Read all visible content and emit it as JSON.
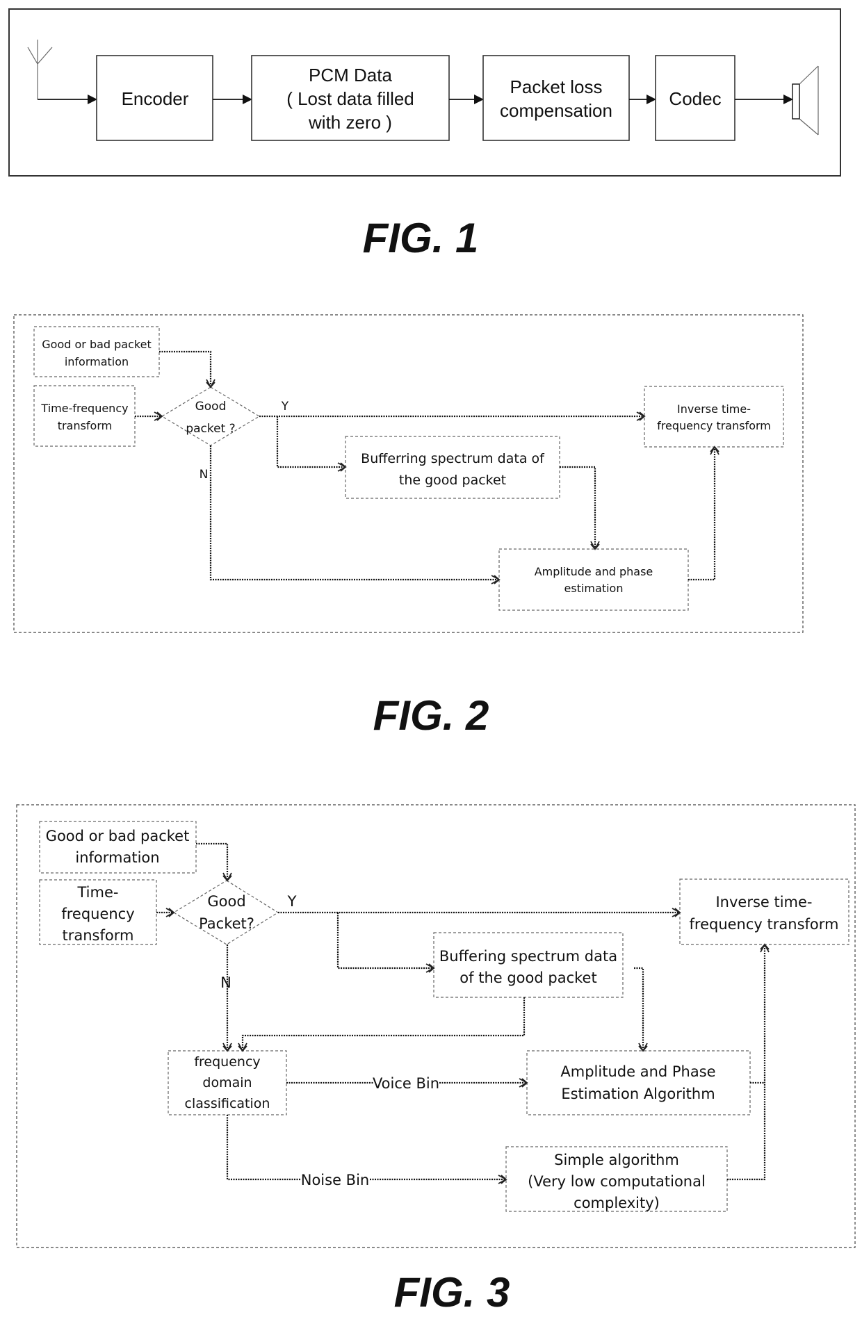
{
  "fig1": {
    "caption": "FIG. 1",
    "encoder": "Encoder",
    "pcm": [
      "PCM Data",
      "( Lost data filled",
      "with zero )"
    ],
    "plc": [
      "Packet loss",
      "compensation"
    ],
    "codec": "Codec"
  },
  "fig2": {
    "caption": "FIG. 2",
    "good_bad_info": [
      "Good or bad packet",
      "information"
    ],
    "tf_transform": [
      "Time-frequency",
      "transform"
    ],
    "decision": [
      "Good",
      "packet ?"
    ],
    "yes_label": "Y",
    "no_label": "N",
    "inverse": [
      "Inverse time-",
      "frequency transform"
    ],
    "buffering": [
      "Bufferring spectrum data of",
      "the good packet"
    ],
    "amp_phase": [
      "Amplitude and phase",
      "estimation"
    ]
  },
  "fig3": {
    "caption": "FIG. 3",
    "good_bad_info": [
      "Good or bad packet",
      "information"
    ],
    "tf_transform": [
      "Time-",
      "frequency",
      "transform"
    ],
    "decision": [
      "Good",
      "Packet?"
    ],
    "yes_label": "Y",
    "no_label": "N",
    "inverse": [
      "Inverse time-",
      "frequency transform"
    ],
    "buffering": [
      "Buffering spectrum data",
      "of the good packet"
    ],
    "classification": [
      "frequency",
      "domain",
      "classification"
    ],
    "voice_bin": "Voice Bin",
    "noise_bin": "Noise Bin",
    "amp_phase": [
      "Amplitude and Phase",
      "Estimation Algorithm"
    ],
    "simple": [
      "Simple algorithm",
      "(Very low computational",
      "complexity)"
    ]
  }
}
